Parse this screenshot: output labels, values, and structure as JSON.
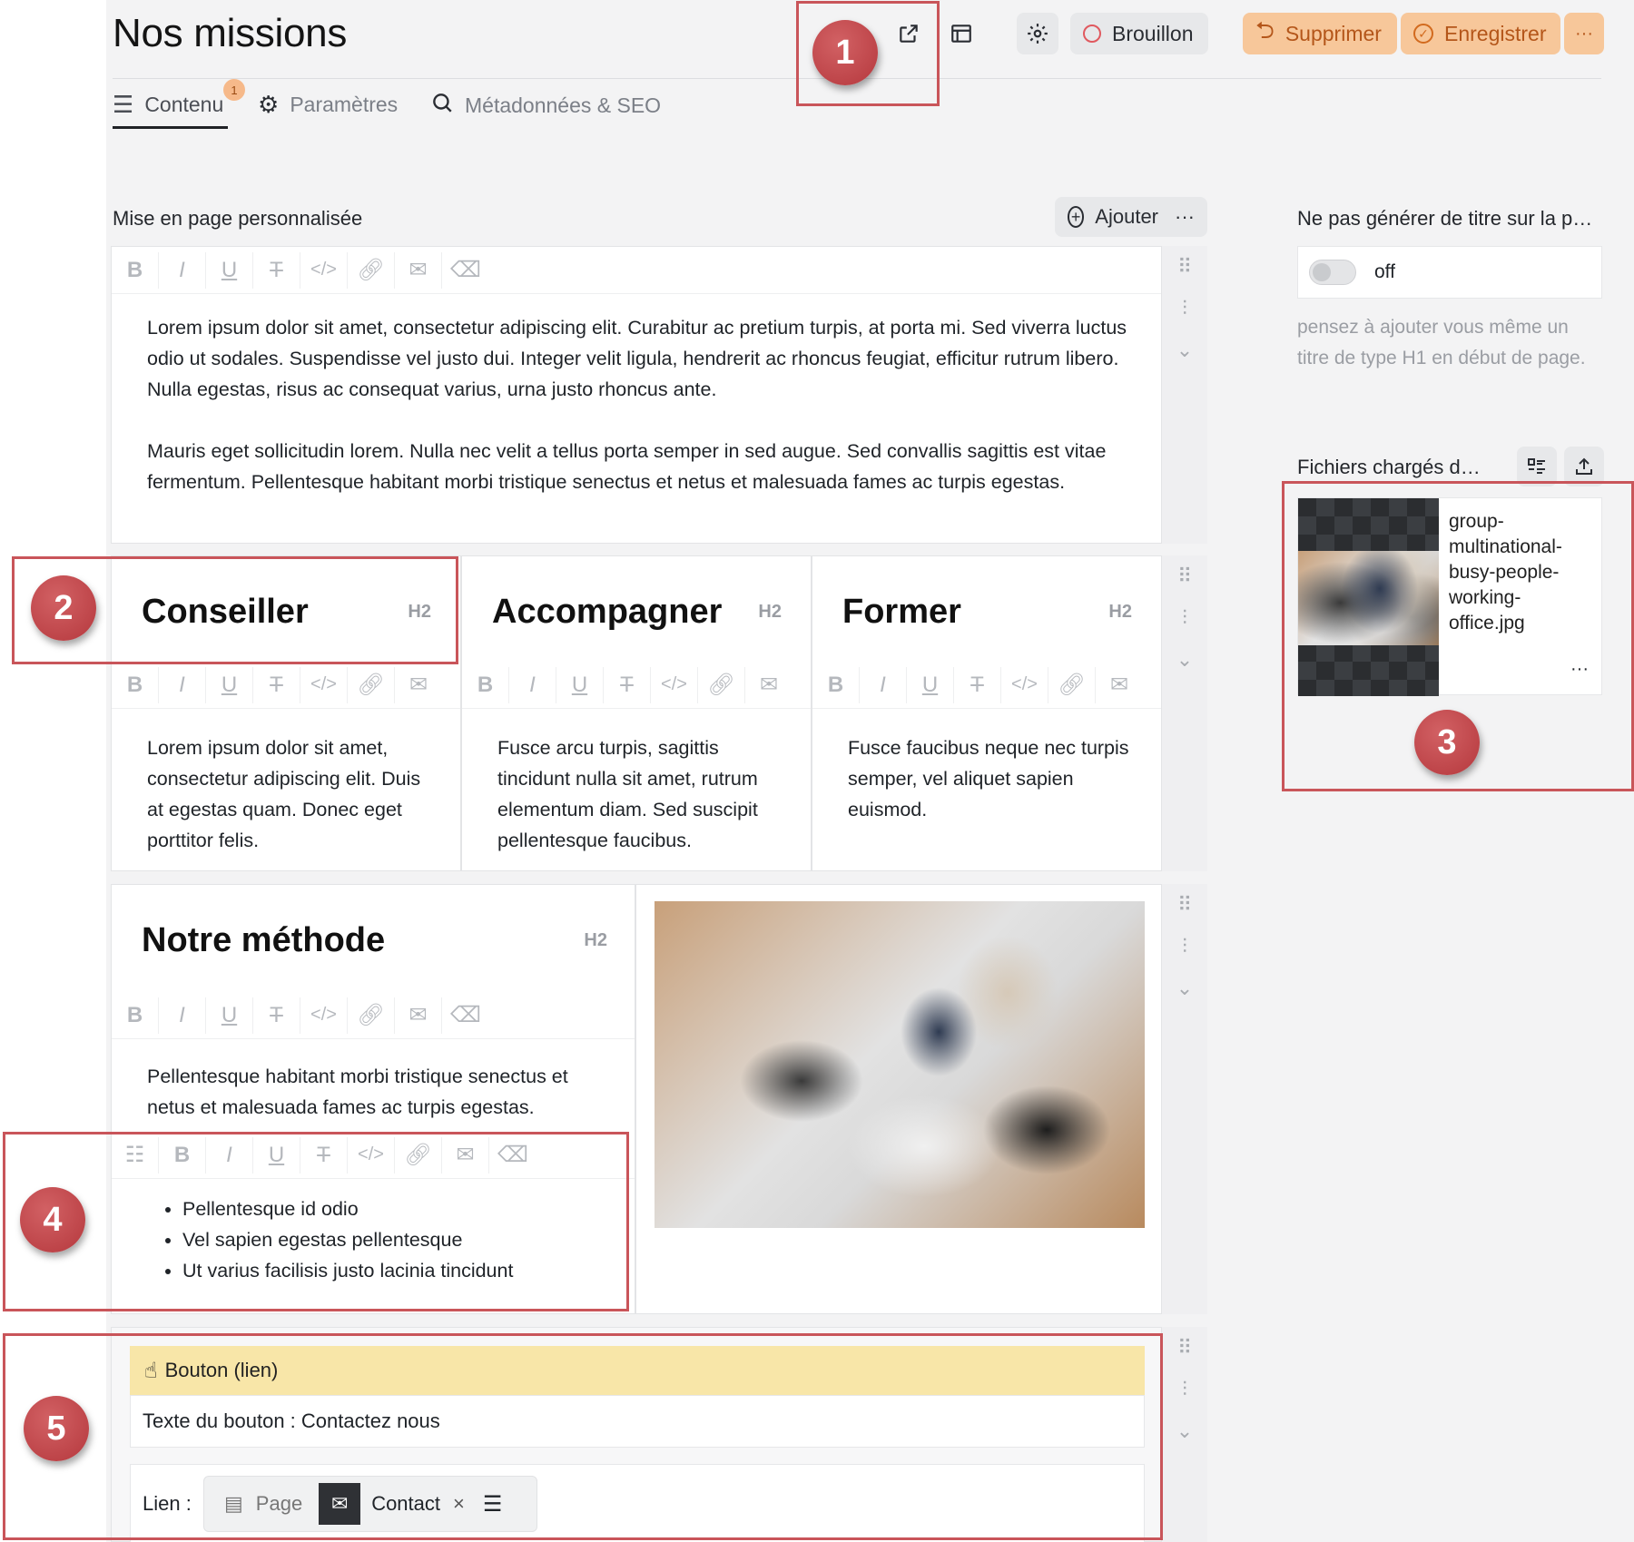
{
  "header": {
    "title": "Nos missions",
    "status_label": "Brouillon",
    "delete_label": "Supprimer",
    "save_label": "Enregistrer",
    "more_label": "···"
  },
  "tabs": [
    {
      "label": "Contenu",
      "badge": "1",
      "icon": "lines-icon"
    },
    {
      "label": "Paramètres",
      "icon": "gear-icon"
    },
    {
      "label": "Métadonnées & SEO",
      "icon": "search-icon"
    }
  ],
  "layout": {
    "label": "Mise en page personnalisée",
    "add_label": "Ajouter",
    "more": "···"
  },
  "blocks": {
    "intro": {
      "paragraph1": "Lorem ipsum dolor sit amet, consectetur adipiscing elit. Curabitur ac pretium turpis, at porta mi. Sed viverra luctus odio ut sodales. Suspendisse vel justo dui. Integer velit ligula, hendrerit ac rhoncus feugiat, efficitur rutrum libero. Nulla egestas, risus ac consequat varius, urna justo rhoncus ante.",
      "paragraph2": "Mauris eget sollicitudin lorem. Nulla nec velit a tellus porta semper in sed augue. Sed convallis sagittis est vitae fermentum. Pellentesque habitant morbi tristique senectus et netus et malesuada fames ac turpis egestas."
    },
    "columns": [
      {
        "title": "Conseiller",
        "tag": "H2",
        "text": "Lorem ipsum dolor sit amet, consectetur adipiscing elit. Duis at egestas quam. Donec eget porttitor felis."
      },
      {
        "title": "Accompagner",
        "tag": "H2",
        "text": "Fusce arcu turpis, sagittis tincidunt nulla sit amet, rutrum elementum diam. Sed suscipit pellentesque faucibus."
      },
      {
        "title": "Former",
        "tag": "H2",
        "text": "Fusce faucibus neque nec turpis semper, vel aliquet sapien euismod."
      }
    ],
    "method": {
      "title": "Notre méthode",
      "tag": "H2",
      "text": "Pellentesque habitant morbi tristique senectus et netus et malesuada fames ac turpis egestas.",
      "list": [
        "Pellentesque id odio",
        "Vel sapien egestas pellentesque",
        "Ut varius facilisis justo lacinia tincidunt"
      ]
    },
    "button": {
      "header": "Bouton (lien)",
      "text_line": "Texte du bouton : Contactez nous",
      "link_label": "Lien :",
      "page_label": "Page",
      "contact_label": "Contact",
      "clear": "×"
    }
  },
  "sidebar": {
    "title_option": "Ne pas générer de titre sur la p…",
    "toggle_state": "off",
    "hint": "pensez à ajouter vous même un titre de type H1 en début de page.",
    "files_label": "Fichiers chargés d…",
    "file_name": "group-multinational-busy-people-working-office.jpg",
    "file_more": "···"
  },
  "annotations": [
    "1",
    "2",
    "3",
    "4",
    "5"
  ],
  "colors": {
    "accent_orange": "#f7c79a",
    "annotation_red": "#c9555a",
    "button_yellow": "#f8e6a8"
  }
}
